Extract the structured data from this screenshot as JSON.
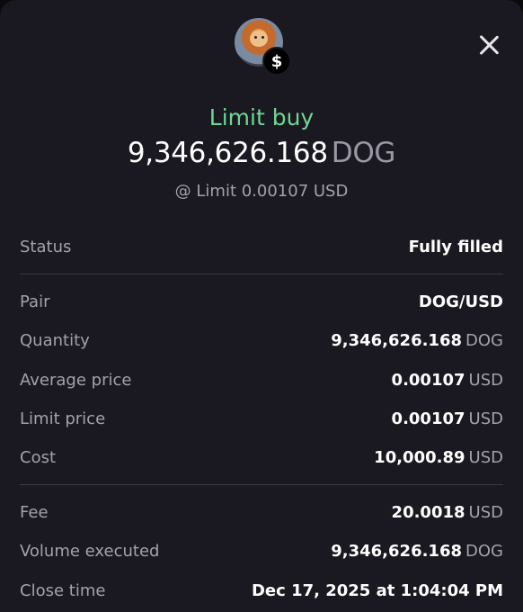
{
  "header": {
    "order_type": "Limit buy",
    "amount": "9,346,626.168",
    "amount_unit": "DOG",
    "limit_text": "@ Limit 0.00107 USD",
    "badge_symbol": "$"
  },
  "details": [
    {
      "label": "Status",
      "value": "Fully filled",
      "unit": ""
    },
    {
      "label": "Pair",
      "value": "DOG/USD",
      "unit": ""
    },
    {
      "label": "Quantity",
      "value": "9,346,626.168",
      "unit": "DOG"
    },
    {
      "label": "Average price",
      "value": "0.00107",
      "unit": "USD"
    },
    {
      "label": "Limit price",
      "value": "0.00107",
      "unit": "USD"
    },
    {
      "label": "Cost",
      "value": "10,000.89",
      "unit": "USD"
    },
    {
      "label": "Fee",
      "value": "20.0018",
      "unit": "USD"
    },
    {
      "label": "Volume executed",
      "value": "9,346,626.168",
      "unit": "DOG"
    },
    {
      "label": "Close time",
      "value": "Dec 17, 2025 at 1:04:04 PM",
      "unit": ""
    }
  ],
  "colors": {
    "accent_green": "#6fd693",
    "background": "#1a1820",
    "muted_text": "#a3a1ad"
  },
  "icons": {
    "avatar": "dog-token-avatar",
    "badge": "dollar-badge-icon",
    "close": "close-icon"
  }
}
